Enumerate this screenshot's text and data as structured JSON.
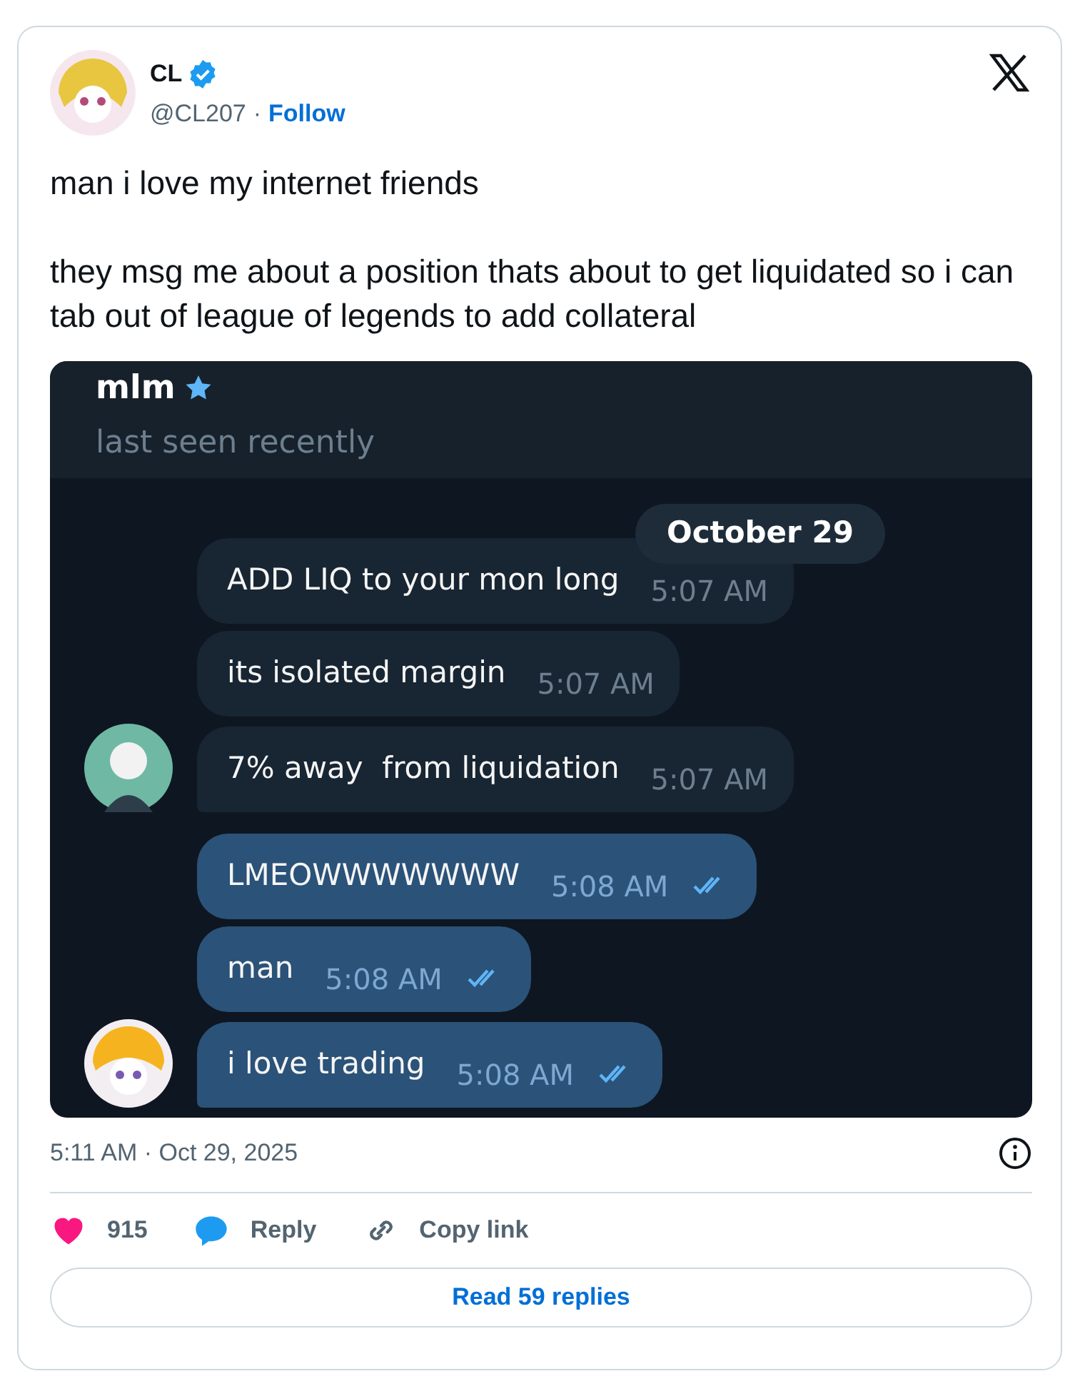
{
  "author": {
    "name": "CL",
    "verified": true,
    "handle": "@CL207",
    "separator": "·",
    "follow": "Follow"
  },
  "text": [
    "man i love my internet friends",
    "they msg me about a position thats about to get liquidated so i can tab out of league of legends to add collateral"
  ],
  "chat": {
    "contact": "mlm",
    "starred": true,
    "status": "last seen recently",
    "date": "October 29",
    "messages": [
      {
        "text": "ADD LIQ to your mon long",
        "time": "5:07 AM",
        "outgoing": false,
        "avatar": false
      },
      {
        "text": "its isolated margin",
        "time": "5:07 AM",
        "outgoing": false,
        "avatar": false
      },
      {
        "text": "7% away  from liquidation",
        "time": "5:07 AM",
        "outgoing": false,
        "avatar": true
      },
      {
        "text": "LMEOWWWWWWW",
        "time": "5:08 AM",
        "outgoing": true,
        "read": true,
        "avatar": false
      },
      {
        "text": "man",
        "time": "5:08 AM",
        "outgoing": true,
        "read": true,
        "avatar": false
      },
      {
        "text": "i love trading",
        "time": "5:08 AM",
        "outgoing": true,
        "read": true,
        "avatar": true
      }
    ]
  },
  "timestamp": "5:11 AM · Oct 29, 2025",
  "actions": [
    {
      "kind": "like",
      "label": "915"
    },
    {
      "kind": "reply",
      "label": "Reply"
    },
    {
      "kind": "copy",
      "label": "Copy link"
    }
  ],
  "read_replies": "Read 59 replies"
}
